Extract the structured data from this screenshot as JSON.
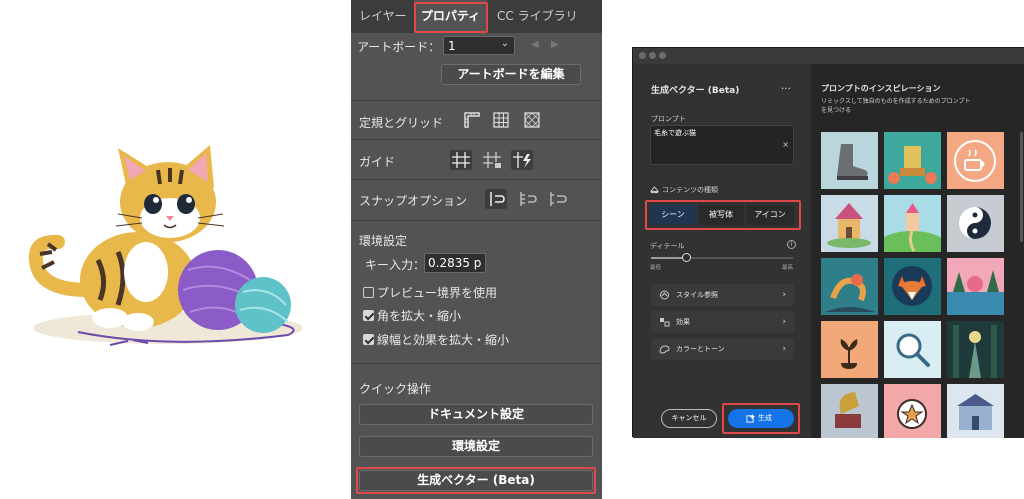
{
  "props": {
    "tabs": [
      "レイヤー",
      "プロパティ",
      "CC ライブラリ"
    ],
    "artboard_label": "アートボード：",
    "artboard_value": "1",
    "edit_artboard": "アートボードを編集",
    "rulers_grids": "定規とグリッド",
    "guides": "ガイド",
    "snap_options": "スナップオプション",
    "preferences": "環境設定",
    "key_input_label": "キー入力：",
    "key_input_value": "0.2835 p",
    "preview_bounds": "プレビュー境界を使用",
    "scale_corners": "角を拡大・縮小",
    "scale_strokes": "線幅と効果を拡大・縮小",
    "quick_actions": "クイック操作",
    "doc_setup": "ドキュメント設定",
    "prefs_btn": "環境設定",
    "gen_vector_btn": "生成ベクター (Beta)"
  },
  "dialog": {
    "title": "生成ベクター (Beta)",
    "more": "…",
    "prompt_label": "プロンプト",
    "prompt_value": "毛糸で遊ぶ猫",
    "clear": "×",
    "content_type_label": "コンテンツの種類",
    "content_types": [
      "シーン",
      "被写体",
      "アイコン"
    ],
    "detail_label": "ディテール",
    "detail_low": "最低",
    "detail_high": "最高",
    "detail_value": 0.25,
    "style_ref": "スタイル参照",
    "effects": "効果",
    "color_tone": "カラーとトーン",
    "cancel": "キャンセル",
    "generate": "生成",
    "inspiration_title": "プロンプトのインスピレーション",
    "inspiration_sub1": "リミックスして独自のものを作成するためのプロンプト",
    "inspiration_sub2": "を見つける"
  }
}
